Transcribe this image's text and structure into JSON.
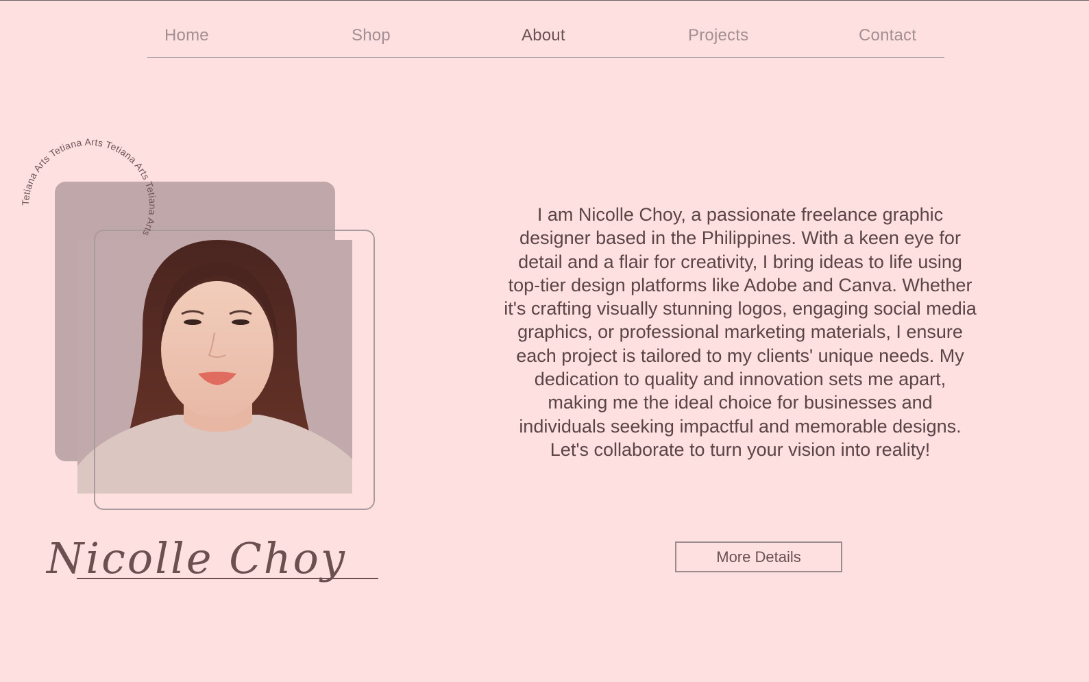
{
  "nav": {
    "items": [
      {
        "label": "Home",
        "active": false
      },
      {
        "label": "Shop",
        "active": false
      },
      {
        "label": "About",
        "active": true
      },
      {
        "label": "Projects",
        "active": false
      },
      {
        "label": "Contact",
        "active": false
      }
    ]
  },
  "stamp": {
    "text": "Tetiana Arts Tetiana Arts Tetiana Arts Tetiana Arts "
  },
  "profile": {
    "signature": "Nicolle Choy",
    "photo_icon": "portrait-photo"
  },
  "bio": {
    "text": "I am Nicolle Choy, a passionate freelance graphic designer based in the Philippines. With a keen eye for detail and a flair for creativity, I bring ideas to life using top-tier design platforms like Adobe and Canva. Whether it's crafting visually stunning logos, engaging social media graphics, or professional marketing materials, I ensure each project is tailored to my clients' unique needs. My dedication to quality and innovation sets me apart, making me the ideal choice for businesses and individuals seeking impactful and memorable designs. Let's collaborate to turn your vision into reality!"
  },
  "cta": {
    "label": "More Details"
  },
  "colors": {
    "background": "#fee0e0",
    "accent_block": "#c0a7a9",
    "text": "#5a4446",
    "nav_inactive": "#a38f92"
  }
}
